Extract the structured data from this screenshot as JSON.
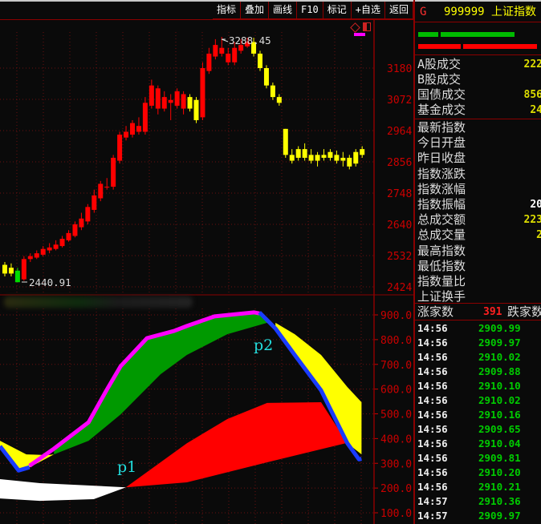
{
  "toolbar": {
    "items": [
      "指标",
      "叠加",
      "画线",
      "F10",
      "标记",
      "+自选",
      "返回"
    ]
  },
  "header": {
    "g_label": "G",
    "code": "999999",
    "name": "上证指数"
  },
  "colors": {
    "up": "#ff0000",
    "down_yellow": "#ffff00",
    "green": "#00dd00",
    "axis": "#cc0000",
    "grid": "#6a1010"
  },
  "price_chart": {
    "high_label": "3288.45",
    "low_label": "2440.91",
    "axis_labels": [
      "3180",
      "3072",
      "2964",
      "2856",
      "2748",
      "2640",
      "2532",
      "2424"
    ],
    "candles": [
      [
        2470,
        2500,
        2510,
        2460,
        "y"
      ],
      [
        2490,
        2470,
        2505,
        2460,
        "y"
      ],
      [
        2480,
        2440,
        2490,
        2440,
        "g"
      ],
      [
        2450,
        2520,
        2530,
        2445,
        "r"
      ],
      [
        2520,
        2530,
        2540,
        2510,
        "r"
      ],
      [
        2525,
        2540,
        2550,
        2520,
        "r"
      ],
      [
        2535,
        2555,
        2565,
        2530,
        "r"
      ],
      [
        2550,
        2560,
        2575,
        2540,
        "r"
      ],
      [
        2555,
        2570,
        2585,
        2550,
        "r"
      ],
      [
        2565,
        2590,
        2600,
        2560,
        "r"
      ],
      [
        2585,
        2610,
        2620,
        2580,
        "r"
      ],
      [
        2600,
        2640,
        2650,
        2595,
        "r"
      ],
      [
        2630,
        2660,
        2680,
        2620,
        "r"
      ],
      [
        2650,
        2700,
        2710,
        2640,
        "r"
      ],
      [
        2690,
        2740,
        2760,
        2680,
        "r"
      ],
      [
        2730,
        2780,
        2790,
        2720,
        "r"
      ],
      [
        2770,
        2770,
        2800,
        2760,
        "r"
      ],
      [
        2770,
        2870,
        2880,
        2760,
        "r"
      ],
      [
        2860,
        2950,
        2960,
        2850,
        "r"
      ],
      [
        2940,
        2960,
        2980,
        2930,
        "r"
      ],
      [
        2950,
        2990,
        3000,
        2940,
        "r"
      ],
      [
        2980,
        2960,
        3010,
        2950,
        "r"
      ],
      [
        2960,
        3060,
        3080,
        2950,
        "r"
      ],
      [
        3050,
        3120,
        3140,
        3040,
        "r"
      ],
      [
        3110,
        3040,
        3120,
        3020,
        "r"
      ],
      [
        3040,
        3080,
        3100,
        3030,
        "r"
      ],
      [
        3070,
        3060,
        3090,
        3000,
        "r"
      ],
      [
        3050,
        3100,
        3110,
        3040,
        "r"
      ],
      [
        3090,
        3040,
        3100,
        3020,
        "r"
      ],
      [
        3040,
        3080,
        3090,
        3030,
        "y"
      ],
      [
        3070,
        3000,
        3080,
        2990,
        "y"
      ],
      [
        3010,
        3180,
        3200,
        3000,
        "r"
      ],
      [
        3170,
        3230,
        3250,
        3160,
        "r"
      ],
      [
        3220,
        3260,
        3280,
        3210,
        "r"
      ],
      [
        3250,
        3230,
        3288,
        3220,
        "r"
      ],
      [
        3230,
        3200,
        3250,
        3190,
        "r"
      ],
      [
        3200,
        3250,
        3270,
        3190,
        "r"
      ],
      [
        3240,
        3260,
        3280,
        3230,
        "r"
      ],
      [
        3255,
        3270,
        3285,
        3250,
        "r"
      ],
      [
        3270,
        3230,
        3285,
        3220,
        "y"
      ],
      [
        3230,
        3180,
        3240,
        3170,
        "y"
      ],
      [
        3180,
        3120,
        3190,
        3110,
        "y"
      ],
      [
        3120,
        3080,
        3130,
        3070,
        "y"
      ],
      [
        3080,
        3060,
        3090,
        3050,
        "y"
      ],
      [
        2970,
        2880,
        2970,
        2870,
        "y"
      ],
      [
        2880,
        2860,
        2900,
        2850,
        "y"
      ],
      [
        2870,
        2900,
        2910,
        2860,
        "y"
      ],
      [
        2900,
        2870,
        2920,
        2860,
        "y"
      ],
      [
        2880,
        2860,
        2900,
        2850,
        "y"
      ],
      [
        2860,
        2880,
        2890,
        2840,
        "y"
      ],
      [
        2880,
        2870,
        2900,
        2860,
        "y"
      ],
      [
        2870,
        2890,
        2900,
        2860,
        "y"
      ],
      [
        2880,
        2860,
        2895,
        2850,
        "y"
      ],
      [
        2860,
        2870,
        2890,
        2840,
        "y"
      ],
      [
        2870,
        2840,
        2880,
        2830,
        "y"
      ],
      [
        2850,
        2890,
        2900,
        2840,
        "y"
      ],
      [
        2880,
        2900,
        2910,
        2870,
        "y"
      ]
    ]
  },
  "indicator": {
    "axis_labels": [
      "900.0",
      "800.0",
      "700.0",
      "600.0",
      "500.0",
      "400.0",
      "300.0",
      "200.0",
      "100.0"
    ],
    "annotations": [
      "p1",
      "p2"
    ],
    "bands": [
      {
        "name": "white",
        "color": "#ffffff",
        "upper": [
          [
            0,
            236
          ],
          [
            6.2,
            220
          ],
          [
            19.6,
            203
          ]
        ],
        "lower": [
          [
            0,
            158
          ],
          [
            6.2,
            148
          ],
          [
            14.6,
            155
          ],
          [
            19.6,
            203
          ]
        ]
      },
      {
        "name": "red",
        "color": "#ff0000",
        "upper": [
          [
            19.6,
            203
          ],
          [
            29.1,
            381
          ],
          [
            35.4,
            479
          ],
          [
            41.6,
            544
          ],
          [
            50,
            547
          ],
          [
            54.1,
            381
          ]
        ],
        "lower": [
          [
            19.6,
            203
          ],
          [
            29.1,
            223
          ],
          [
            41.6,
            304
          ],
          [
            53.8,
            381
          ]
        ]
      },
      {
        "name": "green",
        "color": "#009900",
        "upper": [
          [
            8.4,
            359
          ],
          [
            13.8,
            466
          ],
          [
            16.6,
            596
          ],
          [
            18.8,
            693
          ],
          [
            22.9,
            806
          ],
          [
            27.1,
            835
          ],
          [
            29.1,
            855
          ],
          [
            33.4,
            894
          ],
          [
            39.6,
            910
          ],
          [
            40.6,
            906
          ],
          [
            42.2,
            868
          ]
        ],
        "lower": [
          [
            8.4,
            336
          ],
          [
            13.8,
            391
          ],
          [
            18.8,
            498
          ],
          [
            25,
            660
          ],
          [
            29.1,
            738
          ],
          [
            35.4,
            822
          ],
          [
            41.6,
            868
          ],
          [
            42.2,
            868
          ]
        ]
      },
      {
        "name": "yellow-right",
        "color": "#ffff00",
        "upper": [
          [
            42.9,
            868
          ],
          [
            45.9,
            822
          ],
          [
            50,
            738
          ],
          [
            54.1,
            608
          ],
          [
            56.3,
            547
          ]
        ],
        "lower": [
          [
            56.3,
            336
          ],
          [
            54.1,
            381
          ],
          [
            50,
            595
          ],
          [
            45.9,
            738
          ],
          [
            42.9,
            845
          ]
        ]
      },
      {
        "name": "yellow-left",
        "color": "#ffff00",
        "upper": [
          [
            0,
            391
          ],
          [
            4.1,
            336
          ],
          [
            7.5,
            333
          ],
          [
            8.4,
            336
          ]
        ],
        "lower": [
          [
            8.4,
            336
          ],
          [
            4.6,
            284
          ],
          [
            2.9,
            271
          ],
          [
            0,
            369
          ]
        ]
      }
    ],
    "lines": [
      {
        "name": "magenta",
        "color": "#ff00ff",
        "points": [
          [
            4.6,
            290
          ],
          [
            8.4,
            359
          ],
          [
            13.8,
            466
          ],
          [
            16.6,
            596
          ],
          [
            18.8,
            693
          ],
          [
            22.9,
            806
          ],
          [
            27.1,
            835
          ],
          [
            29.1,
            855
          ],
          [
            33.4,
            894
          ],
          [
            39.6,
            910
          ],
          [
            40.4,
            906
          ]
        ]
      },
      {
        "name": "blue-right",
        "color": "#1a3cff",
        "points": [
          [
            40.4,
            910
          ],
          [
            42.9,
            845
          ],
          [
            45.9,
            738
          ],
          [
            50,
            595
          ],
          [
            54.1,
            381
          ],
          [
            55.9,
            316
          ],
          [
            56.3,
            318
          ]
        ]
      },
      {
        "name": "blue-left",
        "color": "#1a3cff",
        "points": [
          [
            0,
            369
          ],
          [
            2.9,
            271
          ],
          [
            4.6,
            284
          ]
        ]
      }
    ]
  },
  "quote_panel": {
    "stats": [
      {
        "label": "A股成交",
        "value": "222"
      },
      {
        "label": "B股成交",
        "value": ""
      },
      {
        "label": "国债成交",
        "value": "856"
      },
      {
        "label": "基金成交",
        "value": "24"
      }
    ],
    "index_rows": [
      {
        "label": "最新指数",
        "value": ""
      },
      {
        "label": "今日开盘",
        "value": ""
      },
      {
        "label": "昨日收盘",
        "value": ""
      },
      {
        "label": "指数涨跌",
        "value": ""
      },
      {
        "label": "指数涨幅",
        "value": ""
      },
      {
        "label": "指数振幅",
        "value": "20"
      },
      {
        "label": "总成交额",
        "value": "223"
      },
      {
        "label": "总成交量",
        "value": "2"
      },
      {
        "label": "最高指数",
        "value": ""
      },
      {
        "label": "最低指数",
        "value": ""
      },
      {
        "label": "指数量比",
        "value": ""
      },
      {
        "label": "上证换手",
        "value": ""
      }
    ],
    "advance_label": "涨家数",
    "advance_count": "391",
    "decline_label": "跌家数",
    "ticks": [
      [
        "14:56",
        "2909.99"
      ],
      [
        "14:56",
        "2909.97"
      ],
      [
        "14:56",
        "2910.02"
      ],
      [
        "14:56",
        "2909.88"
      ],
      [
        "14:56",
        "2910.10"
      ],
      [
        "14:56",
        "2910.02"
      ],
      [
        "14:56",
        "2910.16"
      ],
      [
        "14:56",
        "2909.65"
      ],
      [
        "14:56",
        "2910.04"
      ],
      [
        "14:56",
        "2909.81"
      ],
      [
        "14:56",
        "2910.20"
      ],
      [
        "14:56",
        "2910.21"
      ],
      [
        "14:57",
        "2910.36"
      ],
      [
        "14:57",
        "2909.97"
      ]
    ]
  }
}
